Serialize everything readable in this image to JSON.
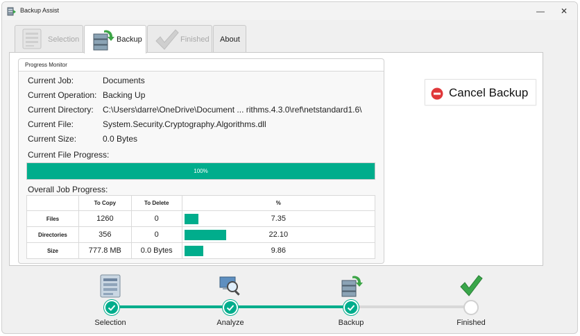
{
  "window": {
    "title": "Backup Assist"
  },
  "tabs": [
    {
      "label": "Selection",
      "state": "disabled",
      "icon": "selection-list-icon"
    },
    {
      "label": "Backup",
      "state": "active",
      "icon": "backup-server-icon"
    },
    {
      "label": "Finished",
      "state": "disabled",
      "icon": "checkmark-icon"
    },
    {
      "label": "About",
      "state": "normal"
    }
  ],
  "progress_monitor": {
    "title": "Progress Monitor",
    "fields": [
      {
        "label": "Current Job:",
        "value": "Documents"
      },
      {
        "label": "Current Operation:",
        "value": "Backing Up"
      },
      {
        "label": "Current Directory:",
        "value": "C:\\Users\\darre\\OneDrive\\Document ... rithms.4.3.0\\ref\\netstandard1.6\\"
      },
      {
        "label": "Current File:",
        "value": "System.Security.Cryptography.Algorithms.dll"
      },
      {
        "label": "Current Size:",
        "value": "0.0 Bytes"
      }
    ],
    "file_progress": {
      "label": "Current File Progress:",
      "percent": 100,
      "text": "100%"
    },
    "overall": {
      "label": "Overall Job Progress:",
      "headers": [
        "",
        "To Copy",
        "To Delete",
        "%"
      ],
      "rows": [
        {
          "name": "Files",
          "to_copy": "1260",
          "to_delete": "0",
          "percent_text": "7.35",
          "percent": 7.35
        },
        {
          "name": "Directories",
          "to_copy": "356",
          "to_delete": "0",
          "percent_text": "22.10",
          "percent": 22.1
        },
        {
          "name": "Size",
          "to_copy": "777.8 MB",
          "to_delete": "0.0 Bytes",
          "percent_text": "9.86",
          "percent": 9.86
        }
      ]
    }
  },
  "cancel_button": {
    "label": "Cancel Backup",
    "icon": "stop-icon",
    "color": "#e0383a"
  },
  "steps": [
    {
      "label": "Selection",
      "state": "done",
      "icon": "selection-list-icon"
    },
    {
      "label": "Analyze",
      "state": "done",
      "icon": "analyze-magnifier-icon"
    },
    {
      "label": "Backup",
      "state": "done",
      "icon": "backup-server-icon"
    },
    {
      "label": "Finished",
      "state": "todo",
      "icon": "checkmark-icon"
    }
  ],
  "colors": {
    "accent": "#00ad8c",
    "stop": "#e0383a"
  }
}
